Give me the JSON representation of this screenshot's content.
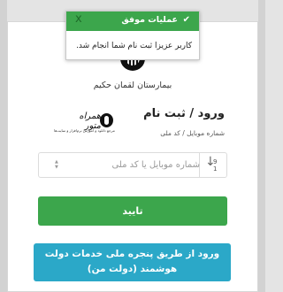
{
  "toast": {
    "title": "عملیات موفق",
    "check_icon": "✔",
    "close_label": "x",
    "message": "کاربر عزیزا ثبت نام شما انجام شد."
  },
  "hospital": {
    "name": "بیمارستان لقمان حکیم"
  },
  "login": {
    "title": "ورود / ثبت نام",
    "subtitle": "شماره موبایل / کد ملی",
    "placeholder": "شماره موبایل یا کد ملی",
    "sort_top": "9",
    "sort_bottom": "1",
    "submit_label": "تایید",
    "gov_label_line1": "ورود از طریق پنجره ملی خدمات دولت",
    "gov_label_line2": "هوشمند (دولت من)"
  },
  "watermark": {
    "name": "همراه متور",
    "tagline": "مرجع دانلود و آموزش نرم‌افزار و سایت‌ها"
  },
  "colors": {
    "success": "#3ca64c",
    "info": "#2ba8c8",
    "background": "#e4e4e4"
  }
}
